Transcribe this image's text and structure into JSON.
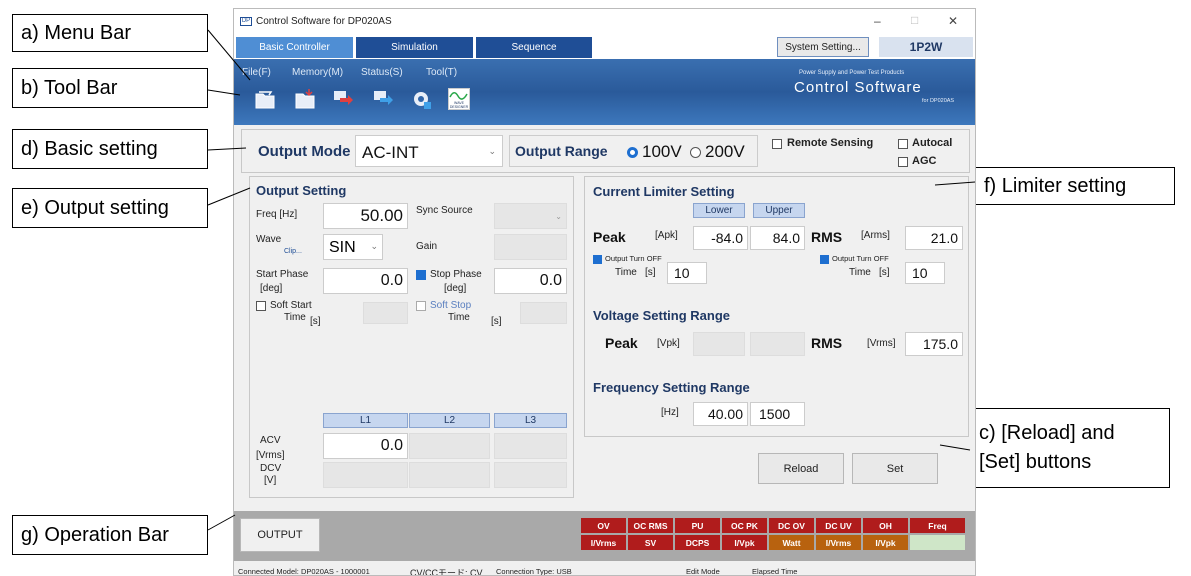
{
  "callouts": {
    "a": "a) Menu Bar",
    "b": "b) Tool Bar",
    "d": "d) Basic setting",
    "e": "e) Output setting",
    "f": "f) Limiter setting",
    "c1": "c) [Reload] and",
    "c2": "[Set] buttons",
    "g": "g) Operation Bar"
  },
  "window": {
    "title": "Control Software for DP020AS",
    "min": "–",
    "max": "□",
    "close": "✕"
  },
  "tabs": [
    "Basic Controller",
    "Simulation",
    "Sequence"
  ],
  "system_setting": "System Setting...",
  "phase_badge": "1P2W",
  "menu": [
    "File(F)",
    "Memory(M)",
    "Status(S)",
    "Tool(T)"
  ],
  "banner": {
    "small": "Power Supply and Power Test Products",
    "big": "Control Software",
    "model": "for DP020AS"
  },
  "toolbar_icons": [
    "open-folder-icon",
    "save-folder-icon",
    "send-icon",
    "receive-icon",
    "gear-icon",
    "wave-designer-icon"
  ],
  "wave_designer_label": "WAVE DESIGNER",
  "basic": {
    "output_mode_label": "Output Mode",
    "output_mode_value": "AC-INT",
    "output_range_label": "Output Range",
    "range_100": "100V",
    "range_200": "200V",
    "remote_sensing": "Remote Sensing",
    "autocal": "Autocal",
    "agc": "AGC"
  },
  "output": {
    "title": "Output Setting",
    "freq_label": "Freq [Hz]",
    "freq_value": "50.00",
    "sync_label": "Sync Source",
    "wave_label": "Wave",
    "clip_label": "Clip...",
    "wave_value": "SIN",
    "gain_label": "Gain",
    "start_phase_label1": "Start Phase",
    "start_phase_label2": "[deg]",
    "start_phase_value": "0.0",
    "stop_phase_label1": "Stop Phase",
    "stop_phase_label2": "[deg]",
    "stop_phase_value": "0.0",
    "soft_start1": "Soft Start",
    "soft_start2": "Time",
    "soft_start_unit": "[s]",
    "soft_stop1": "Soft Stop",
    "soft_stop2": "Time",
    "soft_stop_unit": "[s]",
    "cols": [
      "L1",
      "L2",
      "L3"
    ],
    "acv_label1": "ACV",
    "acv_label2": "[Vrms]",
    "acv_value": "0.0",
    "dcv_label1": "DCV",
    "dcv_label2": "[V]"
  },
  "limiter": {
    "title": "Current Limiter Setting",
    "lower": "Lower",
    "upper": "Upper",
    "peak": "Peak",
    "apk": "[Apk]",
    "peak_lower": "-84.0",
    "peak_upper": "84.0",
    "rms": "RMS",
    "arms": "[Arms]",
    "rms_value": "21.0",
    "turn_off1": "Output Turn OFF",
    "turn_off_time": "Time",
    "turn_off_unit": "[s]",
    "turn_off_value": "10",
    "rms_turn_off1": "Output Turn OFF",
    "rms_turn_off_time": "Time",
    "rms_turn_off_unit": "[s]",
    "rms_turn_off_value": "10",
    "vrange_title": "Voltage Setting Range",
    "v_peak": "Peak",
    "vpk": "[Vpk]",
    "v_rms": "RMS",
    "vrms": "[Vrms]",
    "v_rms_value": "175.0",
    "frange_title": "Frequency Setting Range",
    "hz": "[Hz]",
    "f_low": "40.00",
    "f_high": "1500"
  },
  "buttons": {
    "reload": "Reload",
    "set": "Set",
    "output": "OUTPUT"
  },
  "status_row1": [
    "OV",
    "OC RMS",
    "PU",
    "OC PK",
    "DC OV",
    "DC UV",
    "OH",
    "Freq"
  ],
  "status_row2": [
    "I/Vrms",
    "SV",
    "DCPS",
    "I/Vpk",
    "Watt",
    "I/Vrms",
    "I/Vpk",
    ""
  ],
  "colors": {
    "red": "#b01c1c",
    "orange": "#b8620f",
    "green": "#cfe6c8",
    "blue": "#2f64a8"
  },
  "statusbar": {
    "model": "Connected Model:  DP020AS - 1000001",
    "mode": "CV/CCモード:  CV",
    "conn": "Connection Type:  USB",
    "edit": "Edit Mode",
    "elapsed": "Elapsed Time"
  }
}
